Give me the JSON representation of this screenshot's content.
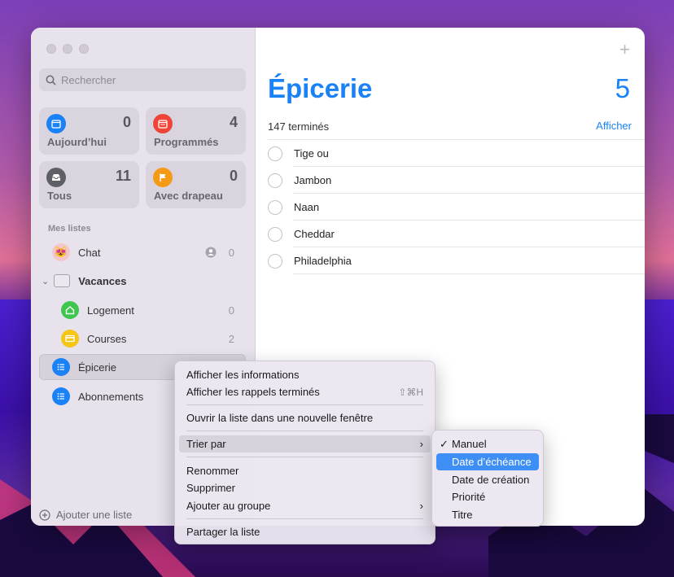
{
  "search": {
    "placeholder": "Rechercher"
  },
  "smart_lists": [
    {
      "label": "Aujourd’hui",
      "count": "0",
      "color": "#1a82f6",
      "icon": "calendar-today-icon"
    },
    {
      "label": "Programmés",
      "count": "4",
      "color": "#ef4538",
      "icon": "calendar-icon"
    },
    {
      "label": "Tous",
      "count": "11",
      "color": "#5f5f66",
      "icon": "tray-icon"
    },
    {
      "label": "Avec drapeau",
      "count": "0",
      "color": "#f59a16",
      "icon": "flag-icon"
    }
  ],
  "my_lists_title": "Mes listes",
  "lists": [
    {
      "label": "Chat",
      "count": "0",
      "icon": "cat-icon"
    },
    {
      "label": "Vacances",
      "icon": "folder-icon"
    },
    {
      "label": "Logement",
      "count": "0",
      "color": "#3ec64f",
      "icon": "home-icon"
    },
    {
      "label": "Courses",
      "count": "2",
      "color": "#f5c518",
      "icon": "card-icon"
    },
    {
      "label": "Épicerie",
      "color": "#1a82f6",
      "icon": "list-icon"
    },
    {
      "label": "Abonnements",
      "color": "#1a82f6",
      "icon": "list-icon"
    }
  ],
  "add_list": "Ajouter une liste",
  "main": {
    "title": "Épicerie",
    "count": "5",
    "plus": "+",
    "done_text": "147 terminés",
    "show_link": "Afficher",
    "tasks": [
      "Tige ou",
      "Jambon",
      "Naan",
      "Cheddar",
      "Philadelphia"
    ]
  },
  "context_menu": {
    "items": [
      "Afficher les informations",
      "Afficher les rappels terminés",
      "Ouvrir la liste dans une nouvelle fenêtre",
      "Trier par",
      "Renommer",
      "Supprimer",
      "Ajouter au groupe",
      "Partager la liste"
    ],
    "shortcut": "⇧⌘H",
    "submenu_arrow": "›"
  },
  "submenu": {
    "items": [
      "Manuel",
      "Date d’échéance",
      "Date de création",
      "Priorité",
      "Titre"
    ],
    "check": "✓"
  }
}
